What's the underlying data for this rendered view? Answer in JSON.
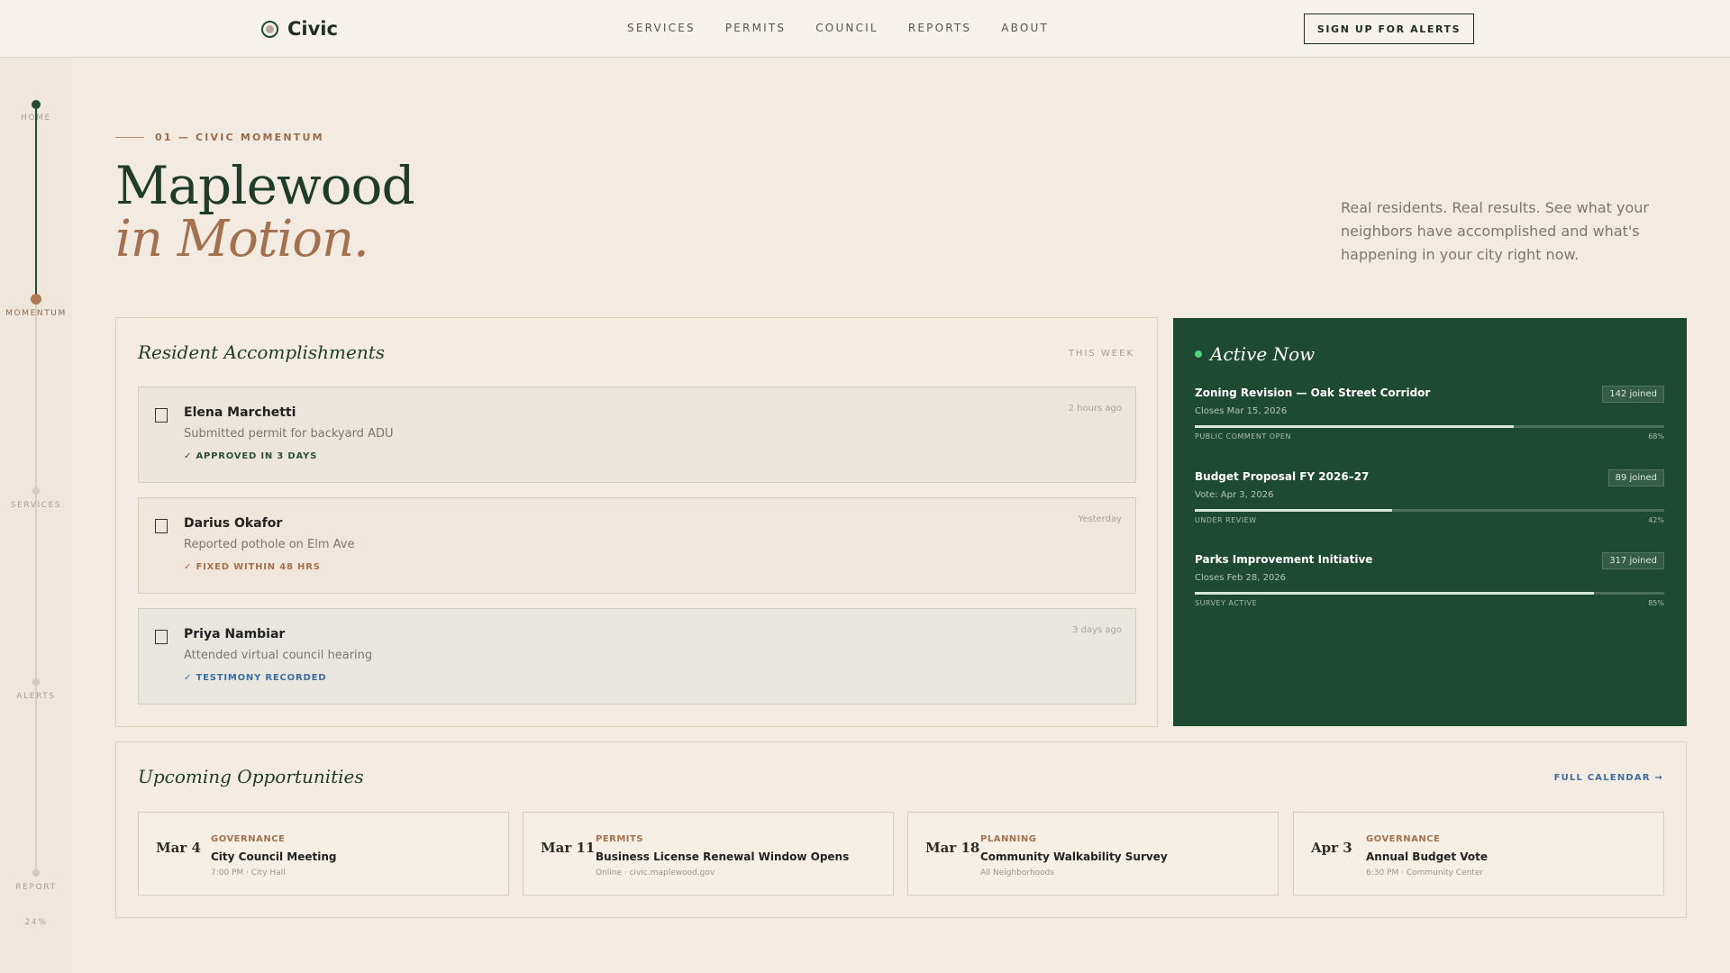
{
  "header": {
    "brand": "Civic",
    "nav": [
      "SERVICES",
      "PERMITS",
      "COUNCIL",
      "REPORTS",
      "ABOUT"
    ],
    "cta": "SIGN UP FOR ALERTS"
  },
  "rail": {
    "sections": [
      "HOME",
      "MOMENTUM",
      "SERVICES",
      "ALERTS",
      "REPORT"
    ],
    "progress": "24%",
    "progress_value": 24
  },
  "hero": {
    "eyebrow": "01 — CIVIC MOMENTUM",
    "title_line1": "Maplewood",
    "title_line2": "in Motion.",
    "intro": "Real residents. Real results. See what your neighbors have accomplished and what's happening in your city right now."
  },
  "accomplishments": {
    "title": "Resident Accomplishments",
    "period": "THIS WEEK",
    "items": [
      {
        "name": "Elena Marchetti",
        "desc": "Submitted permit for backyard ADU",
        "badge": "✓  APPROVED IN 3 DAYS",
        "time": "2 hours ago",
        "badge_color": "#2c4f3a",
        "bg": "#ebe5dc"
      },
      {
        "name": "Darius Okafor",
        "desc": "Reported pothole on Elm Ave",
        "badge": "✓  FIXED WITHIN 48 HRS",
        "time": "Yesterday",
        "badge_color": "#a4714f",
        "bg": "#f1e6da"
      },
      {
        "name": "Priya Nambiar",
        "desc": "Attended virtual council hearing",
        "badge": "✓  TESTIMONY RECORDED",
        "time": "3 days ago",
        "badge_color": "#3d6d9e",
        "bg": "#e9e6e0"
      }
    ]
  },
  "active": {
    "title": "Active Now",
    "items": [
      {
        "name": "Zoning Revision — Oak Street Corridor",
        "sub": "Closes Mar 15, 2026",
        "joined": "142 joined",
        "status": "PUBLIC COMMENT OPEN",
        "pct": "68%",
        "value": 68
      },
      {
        "name": "Budget Proposal FY 2026–27",
        "sub": "Vote: Apr 3, 2026",
        "joined": "89 joined",
        "status": "UNDER REVIEW",
        "pct": "42%",
        "value": 42
      },
      {
        "name": "Parks Improvement Initiative",
        "sub": "Closes Feb 28, 2026",
        "joined": "317 joined",
        "status": "SURVEY ACTIVE",
        "pct": "85%",
        "value": 85
      }
    ]
  },
  "upcoming": {
    "title": "Upcoming Opportunities",
    "link": "FULL CALENDAR →",
    "events": [
      {
        "date": "Mar 4",
        "category": "GOVERNANCE",
        "title": "City Council Meeting",
        "meta": "7:00 PM · City Hall"
      },
      {
        "date": "Mar 11",
        "category": "PERMITS",
        "title": "Business License Renewal Window Opens",
        "meta": "Online · civic.maplewood.gov"
      },
      {
        "date": "Mar 18",
        "category": "PLANNING",
        "title": "Community Walkability Survey",
        "meta": "All Neighborhoods"
      },
      {
        "date": "Apr 3",
        "category": "GOVERNANCE",
        "title": "Annual Budget Vote",
        "meta": "6:30 PM · Community Center"
      }
    ]
  }
}
